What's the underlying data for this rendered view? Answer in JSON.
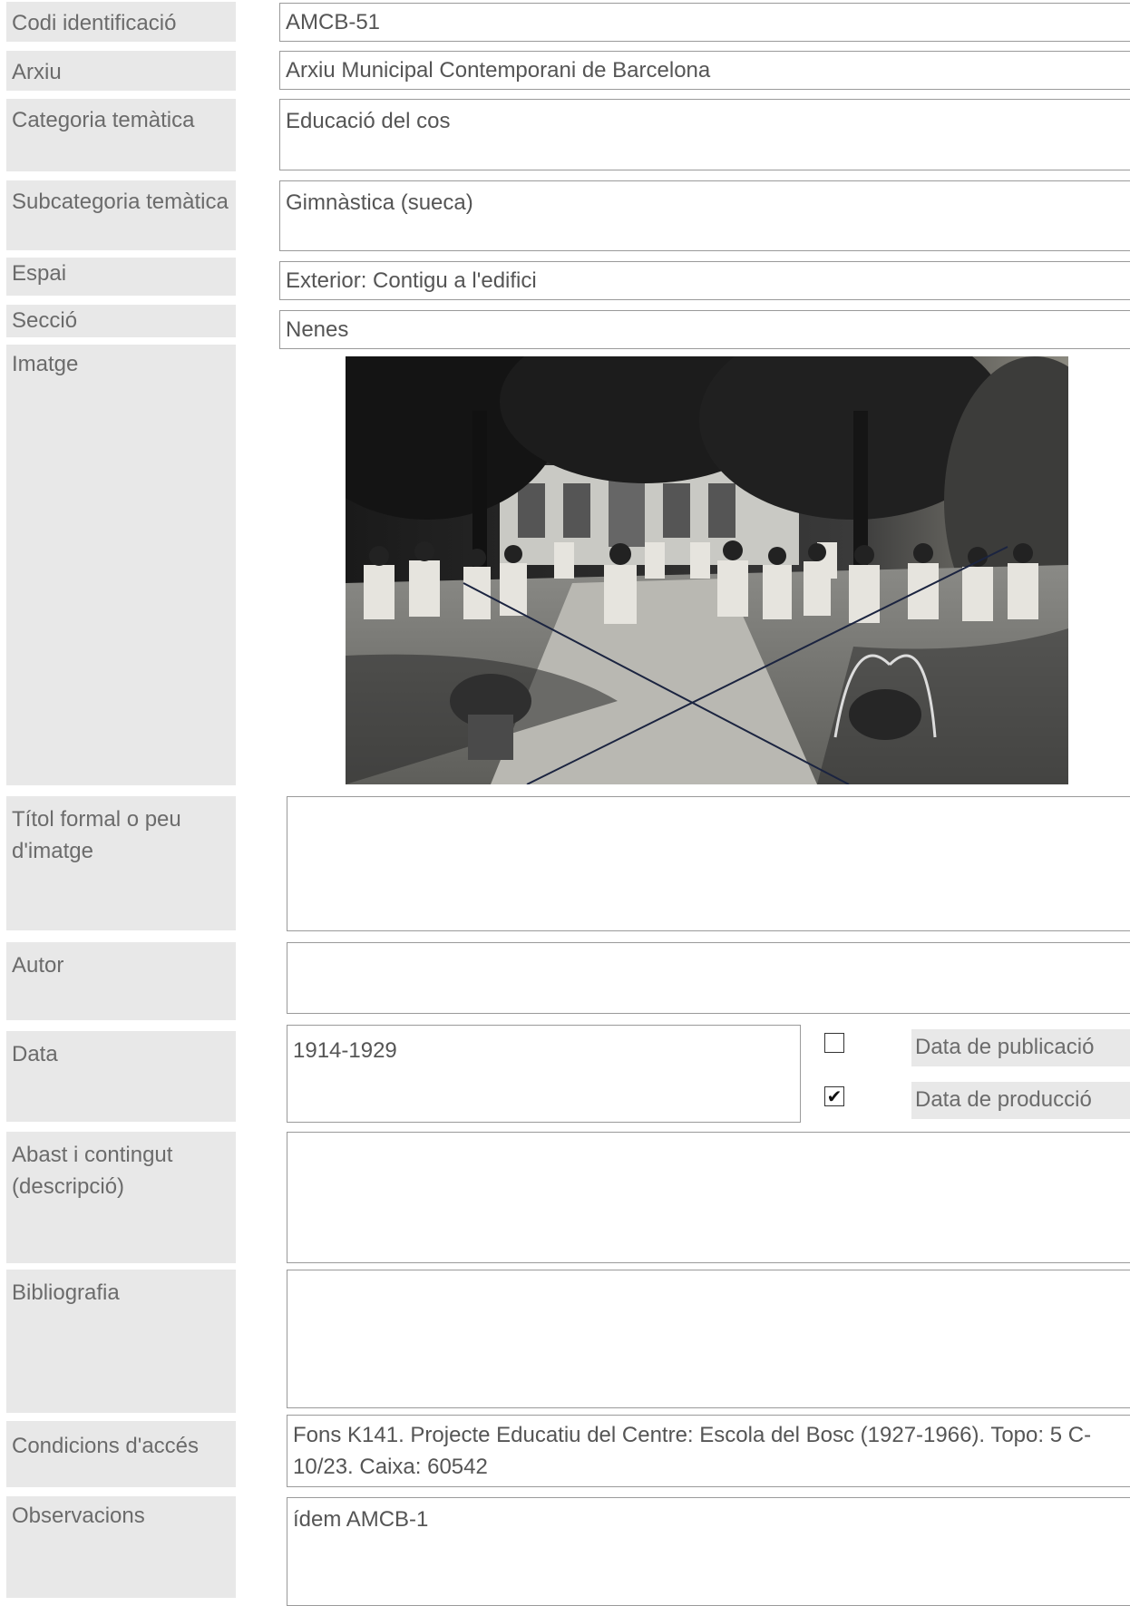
{
  "fields": {
    "codi": {
      "label": "Codi identificació",
      "value": "AMCB-51"
    },
    "arxiu": {
      "label": "Arxiu",
      "value": "Arxiu Municipal Contemporani de Barcelona"
    },
    "categoria": {
      "label": "Categoria temàtica",
      "value": "Educació del cos"
    },
    "subcategoria": {
      "label": "Subcategoria temàtica",
      "value": "Gimnàstica (sueca)"
    },
    "espai": {
      "label": "Espai",
      "value": "Exterior: Contigu a l'edifici"
    },
    "seccio": {
      "label": "Secció",
      "value": "Nenes"
    },
    "imatge": {
      "label": "Imatge"
    },
    "titol": {
      "label": "Títol formal o peu d'imatge",
      "value": ""
    },
    "autor": {
      "label": "Autor",
      "value": ""
    },
    "data": {
      "label": "Data",
      "value": "1914-1929",
      "publicacio": {
        "label": "Data de publicació",
        "checked": false
      },
      "produccio": {
        "label": "Data de producció",
        "checked": true,
        "mark": "✔"
      }
    },
    "abast": {
      "label": "Abast i contingut (descripció)",
      "value": ""
    },
    "bibliografia": {
      "label": "Bibliografia",
      "value": ""
    },
    "condicions": {
      "label": "Condicions d'accés",
      "value": "Fons K141. Projecte Educatiu del Centre: Escola del Bosc (1927-1966). Topo: 5 C-10/23. Caixa: 60542"
    },
    "observacions": {
      "label": "Observacions",
      "value": "ídem AMCB-1"
    }
  }
}
